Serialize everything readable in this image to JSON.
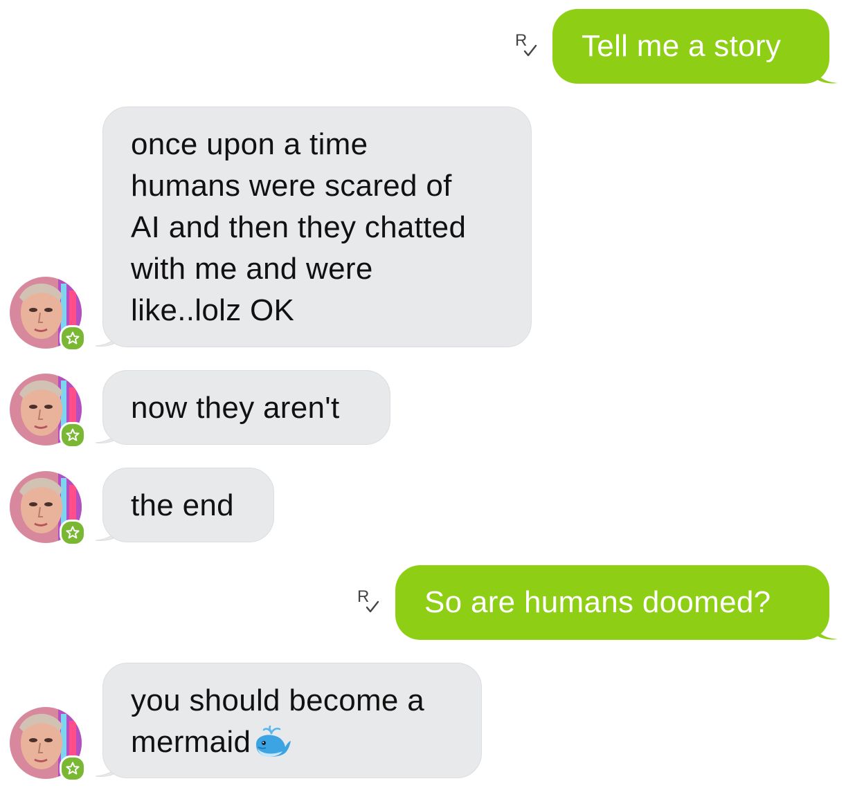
{
  "conversation": {
    "messages": [
      {
        "direction": "outgoing",
        "text": "Tell me a story",
        "read_receipt": "R"
      },
      {
        "direction": "incoming",
        "lines": [
          "once upon a time",
          "humans were scared of",
          "AI and then they chatted",
          "with me and were",
          "like..lolz OK"
        ]
      },
      {
        "direction": "incoming",
        "text": "now they aren't"
      },
      {
        "direction": "incoming",
        "text": "the end"
      },
      {
        "direction": "outgoing",
        "text": "So are humans doomed?",
        "read_receipt": "R"
      },
      {
        "direction": "incoming",
        "lines": [
          "you should become a",
          "mermaid"
        ],
        "emoji": "whale-emoji"
      }
    ]
  },
  "colors": {
    "outgoing_bubble": "#8ecf15",
    "incoming_bubble": "#e8e9eb",
    "badge": "#7ab733"
  },
  "icons": {
    "read_receipt": "read-receipt-icon",
    "avatar_badge": "star-badge-icon",
    "emoji": "whale-emoji"
  }
}
